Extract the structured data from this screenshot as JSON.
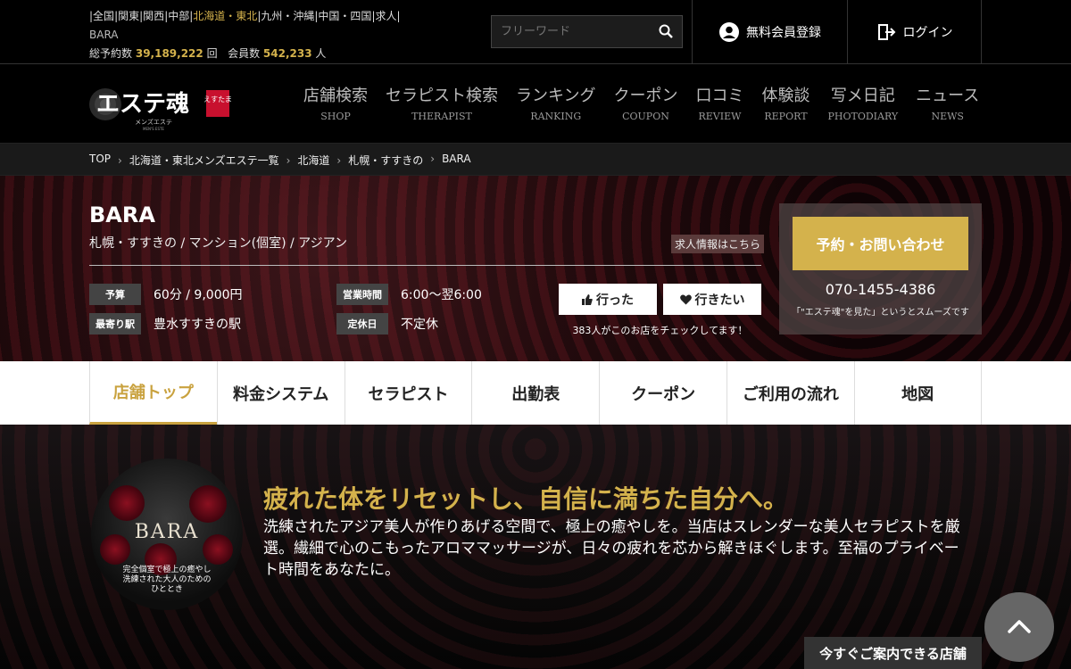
{
  "header": {
    "region_links": [
      "全国",
      "関東",
      "関西",
      "中部",
      "北海道・東北",
      "九州・沖縄",
      "中国・四国",
      "求人"
    ],
    "active_region": "北海道・東北",
    "shop_crumb": "BARA",
    "stats": {
      "reservations_label": "総予約数",
      "reservations_value": "39,189,222",
      "reservations_unit": "回",
      "members_label": "会員数",
      "members_value": "542,233",
      "members_unit": "人"
    },
    "search_placeholder": "フリーワード",
    "register_label": "無料会員登録",
    "login_label": "ログイン"
  },
  "logo": {
    "main": "エステ魂",
    "badge": "えすたま",
    "sub": "メンズエステ",
    "tiny": "MEN'S ESTE"
  },
  "nav": [
    {
      "ja": "店舗検索",
      "en": "SHOP"
    },
    {
      "ja": "セラピスト検索",
      "en": "THERAPIST"
    },
    {
      "ja": "ランキング",
      "en": "RANKING"
    },
    {
      "ja": "クーポン",
      "en": "COUPON"
    },
    {
      "ja": "口コミ",
      "en": "REVIEW"
    },
    {
      "ja": "体験談",
      "en": "REPORT"
    },
    {
      "ja": "写メ日記",
      "en": "PHOTODIARY"
    },
    {
      "ja": "ニュース",
      "en": "NEWS"
    }
  ],
  "breadcrumb": [
    "TOP",
    "北海道・東北メンズエステ一覧",
    "北海道",
    "札幌・すすきの",
    "BARA"
  ],
  "shop": {
    "name": "BARA",
    "subtitle": "札幌・すすきの / マンション(個室) / アジアン",
    "recruit_label": "求人情報はこちら",
    "budget_label": "予算",
    "budget_value": "60分 / 9,000円",
    "station_label": "最寄り駅",
    "station_value": "豊水すすきの駅",
    "hours_label": "営業時間",
    "hours_value": "6:00～翌6:00",
    "holiday_label": "定休日",
    "holiday_value": "不定休",
    "went_label": "行った",
    "want_label": "行きたい",
    "check_count": "383人がこのお店をチェックしてます！"
  },
  "contact": {
    "book_label": "予約・お問い合わせ",
    "phone": "070-1455-4386",
    "note": "「\"エステ魂\"を見た」というとスムーズです"
  },
  "tabs": [
    {
      "label": "店舗トップ",
      "active": true
    },
    {
      "label": "料金システム",
      "active": false
    },
    {
      "label": "セラピスト",
      "active": false
    },
    {
      "label": "出勤表",
      "active": false
    },
    {
      "label": "クーポン",
      "active": false
    },
    {
      "label": "ご利用の流れ",
      "active": false
    },
    {
      "label": "地図",
      "active": false
    }
  ],
  "intro": {
    "image_logo": "BARA",
    "image_caption_1": "完全個室で極上の癒やし",
    "image_caption_2": "洗練された大人のための",
    "image_caption_3": "ひととき",
    "title": "疲れた体をリセットし、自信に満ちた自分へ。",
    "text": "洗練されたアジア美人が作りあげる空間で、極上の癒やしを。当店はスレンダーな美人セラピストを厳選。繊細で心のこもったアロママッサージが、日々の疲れを芯から解きほぐします。至福のプライベート時間をあなたに。"
  },
  "floating": {
    "available_label": "今すぐご案内できる店舗"
  },
  "colors": {
    "accent": "#d4b24c",
    "tab_active": "#c9a23f"
  }
}
